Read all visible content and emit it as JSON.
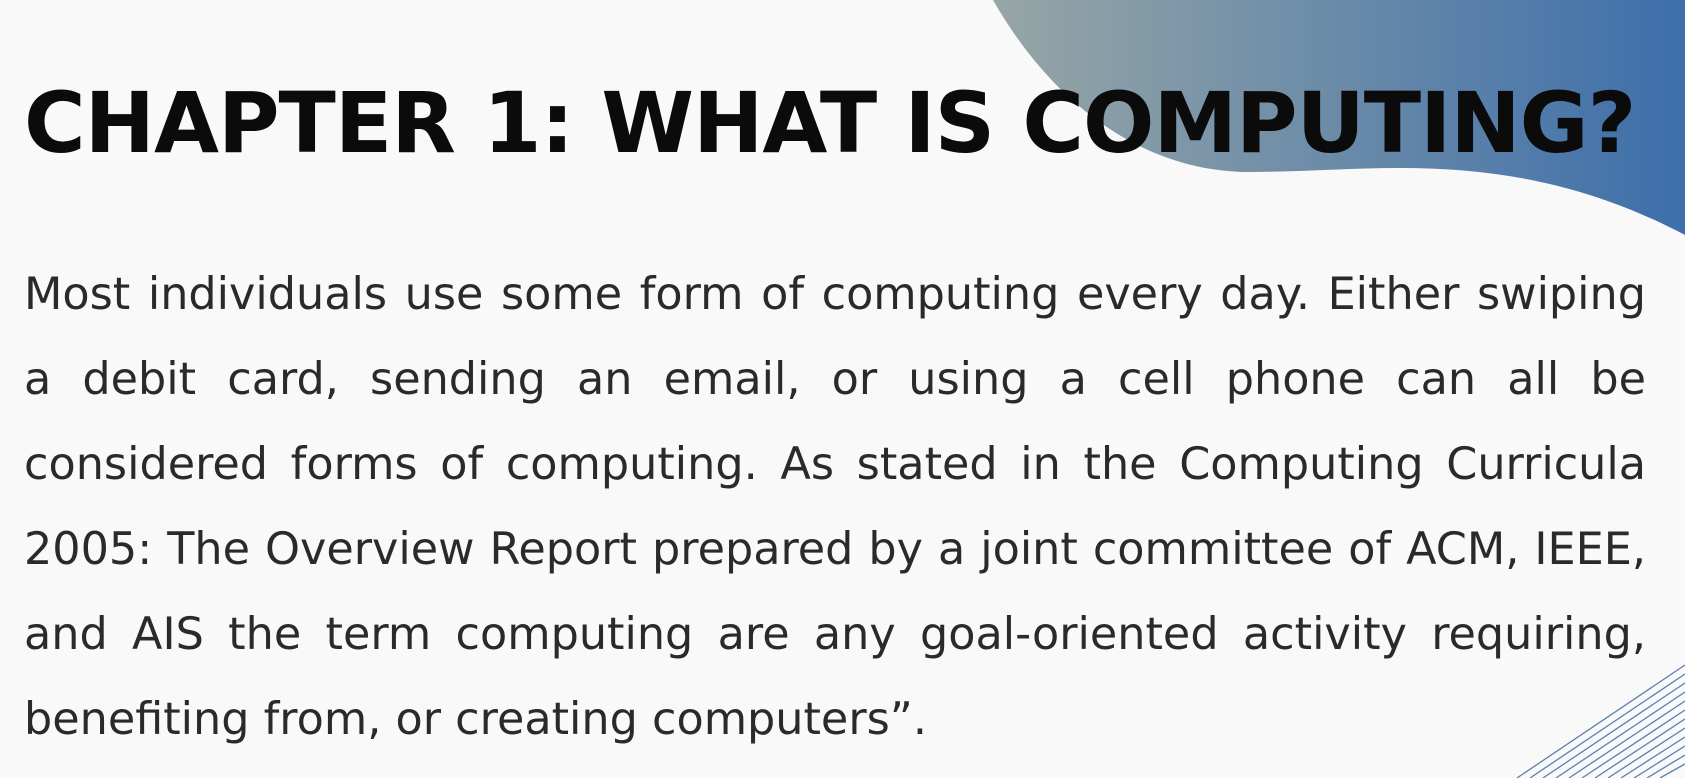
{
  "slide": {
    "title": "CHAPTER 1: WHAT IS COMPUTING?",
    "body": "Most individuals use some form of computing every day. Either swiping a debit card, sending an email, or using a cell phone can all be considered forms of computing. As stated in the Computing Curricula 2005: The Overview Report prepared by a joint committee of ACM, IEEE, and AIS the term computing are any goal-oriented activity requiring, benefiting from, or creating computers”."
  },
  "colors": {
    "background": "#f9f9f9",
    "text": "#2a2a2a",
    "title": "#0b0b0b",
    "accent_gradient_start": "#97a6a6",
    "accent_gradient_end": "#3d6fab",
    "line_pattern": "#5b7fb0"
  }
}
